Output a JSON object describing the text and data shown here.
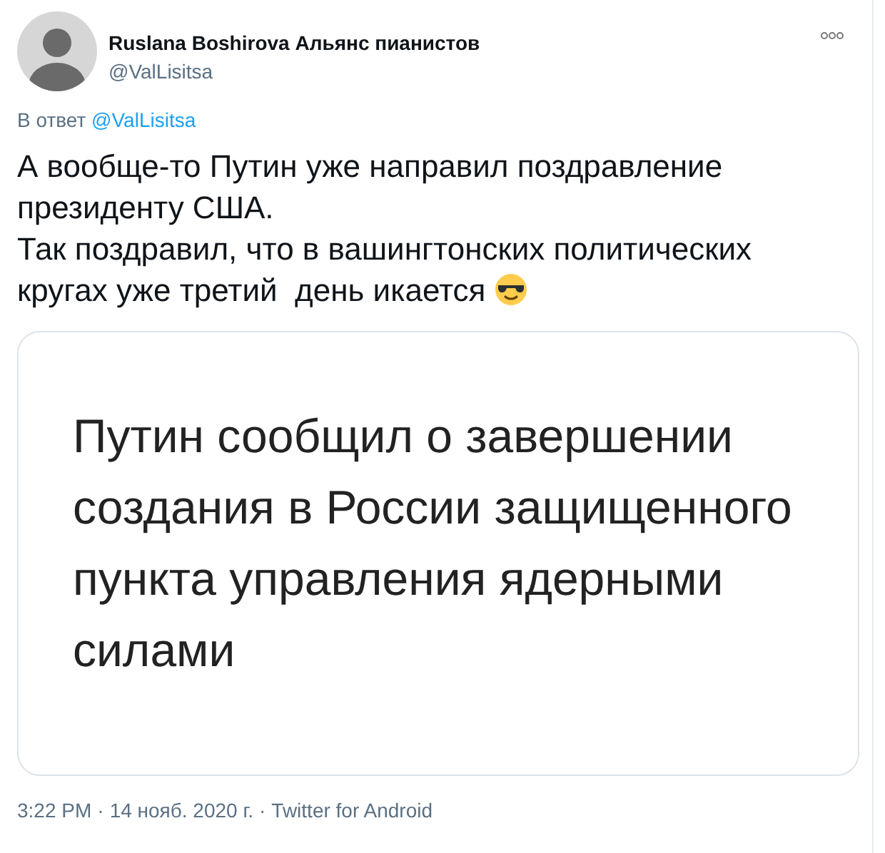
{
  "author": {
    "name": "Ruslana Boshirova Альянс пианистов",
    "handle": "@ValLisitsa"
  },
  "reply_to": {
    "label": "В ответ",
    "handle": "@ValLisitsa"
  },
  "text": [
    "А вообще-то Путин уже направил поздравление президенту США.",
    "Так поздравил, что в вашингтонских политических кругах уже третий  день икается"
  ],
  "embedded_image": {
    "headline": "Путин сообщил о завершении создания в России защищенного пункта управления ядерными силами"
  },
  "meta": {
    "time": "3:22 PM",
    "separator": "·",
    "date": "14 нояб. 2020 г.",
    "source": "Twitter for Android"
  }
}
